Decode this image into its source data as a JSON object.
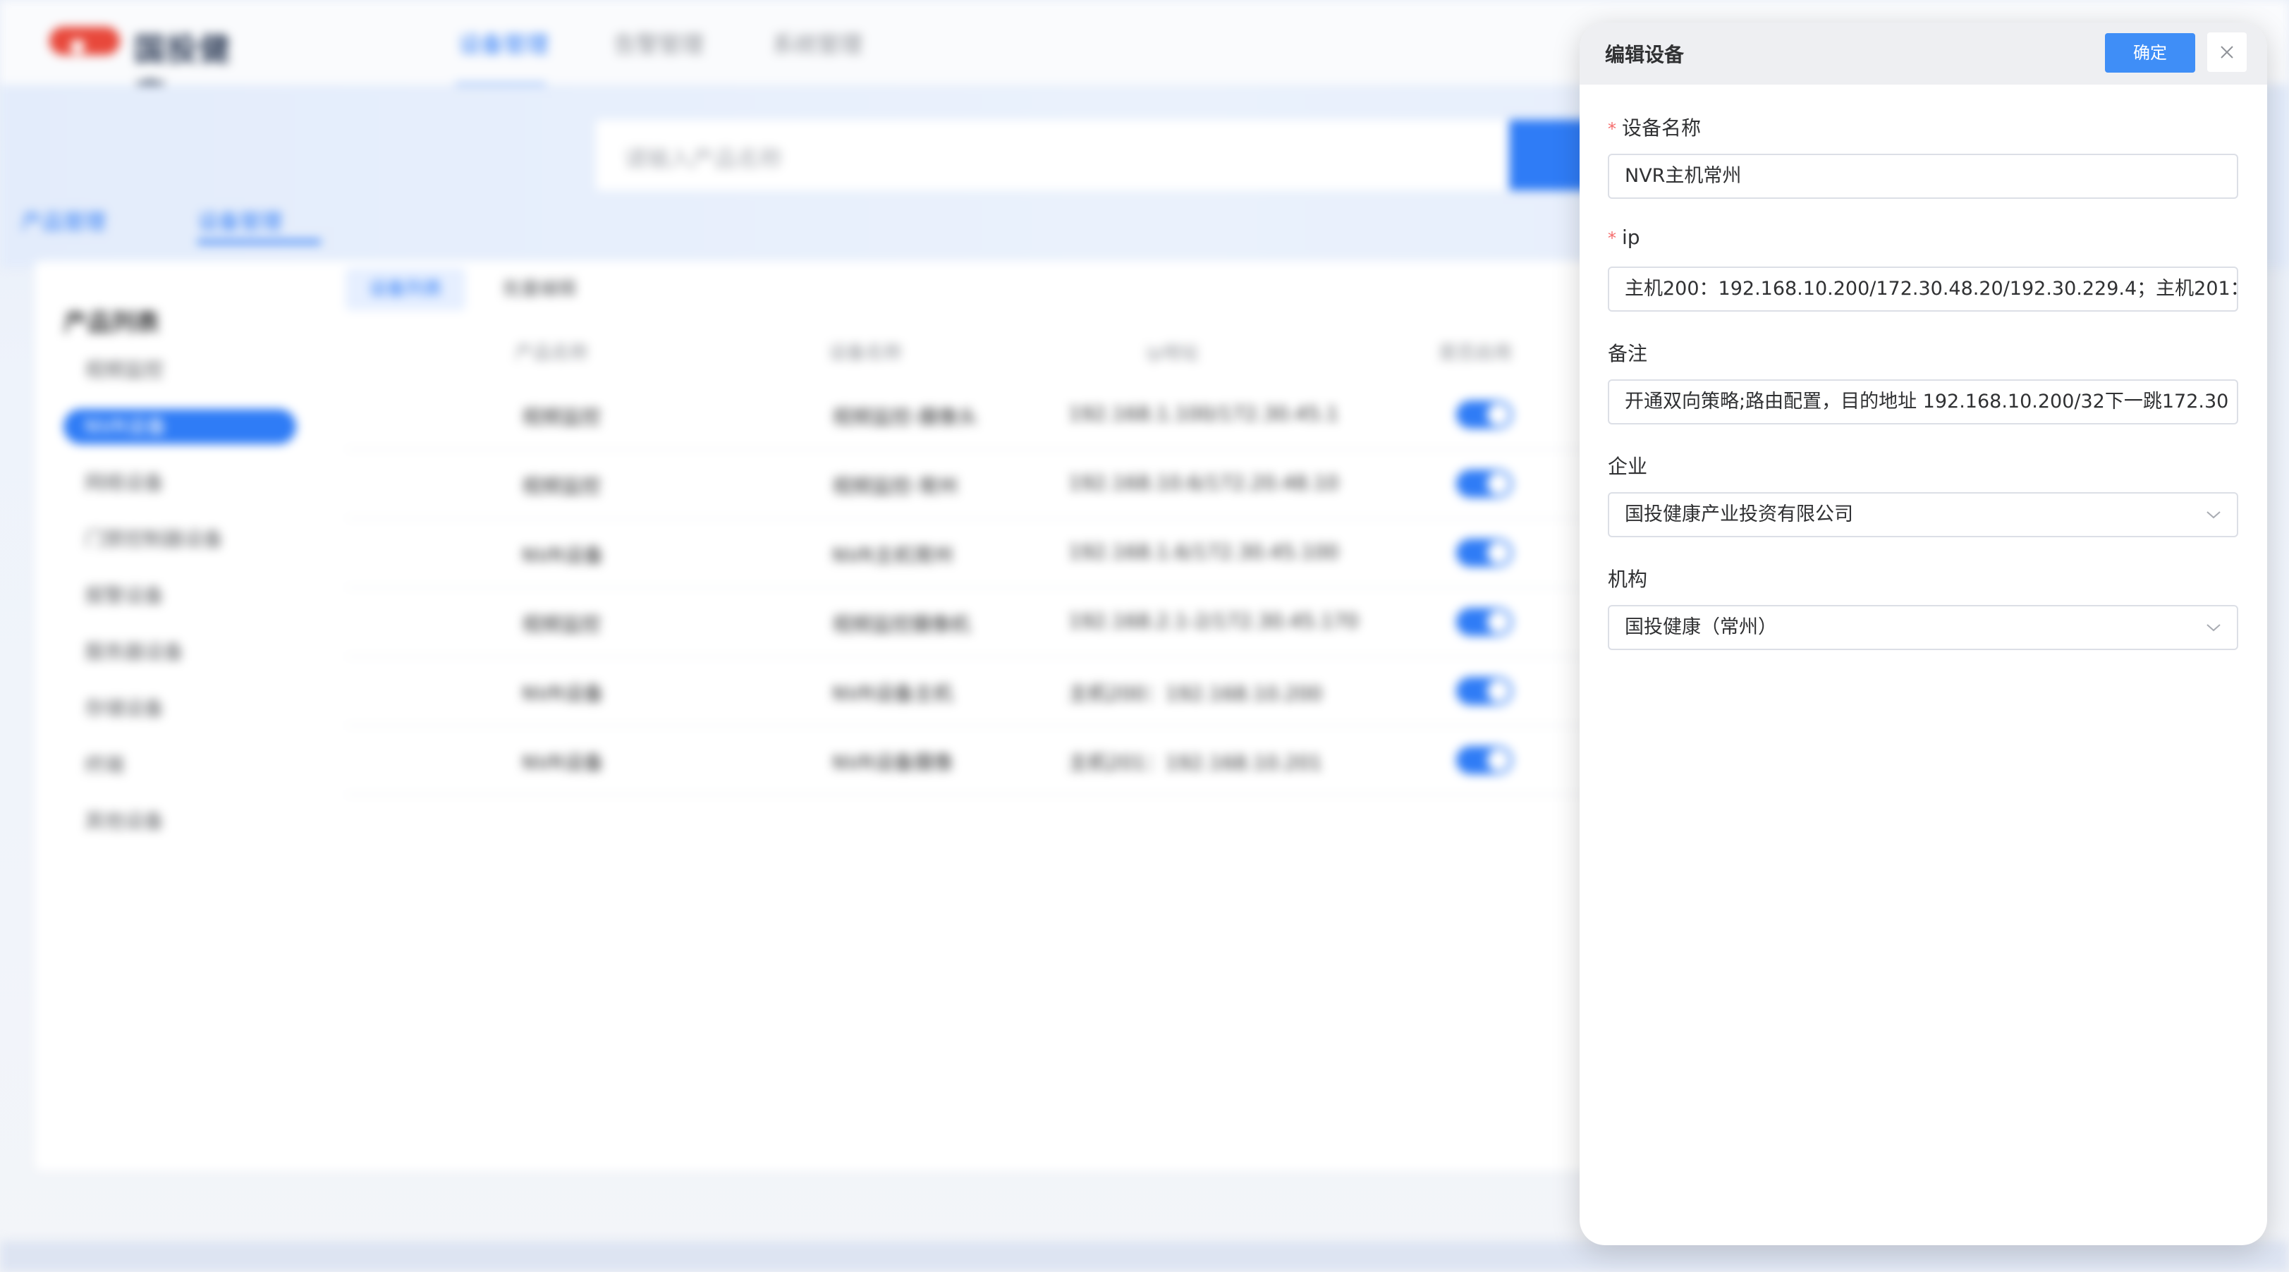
{
  "background": {
    "app_name": "国投健康",
    "nav_tabs": [
      "设备管理",
      "告警管理",
      "系统管理"
    ],
    "search_placeholder": "请输入产品名称",
    "mode_tabs": [
      "产品管理",
      "设备管理"
    ],
    "sidebar_title": "产品列表",
    "sidebar_items": [
      "视频监控",
      "NVR设备",
      "网络设备",
      "门禁控制器设备",
      "报警设备",
      "服务器设备",
      "存储设备",
      "终端",
      "其他设备"
    ],
    "sub_tabs": [
      "设备列表",
      "批量编辑"
    ],
    "table_headers": [
      "产品名称",
      "设备名称",
      "ip地址",
      "是否启用"
    ],
    "rows": [
      [
        "视频监控",
        "视频监控-摄像头",
        "192.168.1.100/172.30.45.1"
      ],
      [
        "视频监控",
        "视频监控-常州",
        "192.168.10.6/172.20.48.10"
      ],
      [
        "NVR设备",
        "NVR主机常州",
        "192.168.1.6/172.30.45.100"
      ],
      [
        "视频监控",
        "视频监控摄像机",
        "192.168.2.1-2/172.30.45.170"
      ],
      [
        "NVR设备",
        "NVR设备主机",
        "主机200：192.168.10.200"
      ],
      [
        "NVR设备",
        "NVR设备摄像",
        "主机201：192.168.10.201"
      ]
    ]
  },
  "drawer": {
    "title": "编辑设备",
    "confirm_label": "确定",
    "close_icon": "close-icon",
    "fields": {
      "device_name": {
        "label": "设备名称",
        "required": true,
        "value": "NVR主机常州"
      },
      "ip": {
        "label": "ip",
        "required": true,
        "value": "主机200：192.168.10.200/172.30.48.20/192.30.229.4；主机201："
      },
      "remark": {
        "label": "备注",
        "required": false,
        "value": "开通双向策略;路由配置，目的地址 192.168.10.200/32下一跳172.30"
      },
      "enterprise": {
        "label": "企业",
        "required": false,
        "value": "国投健康产业投资有限公司"
      },
      "organization": {
        "label": "机构",
        "required": false,
        "value": "国投健康（常州）"
      }
    }
  },
  "colors": {
    "primary": "#2f7cf6",
    "confirm_button": "#3f8ef7",
    "required_mark": "#f56c6c",
    "header_bg": "#eeeff2"
  }
}
